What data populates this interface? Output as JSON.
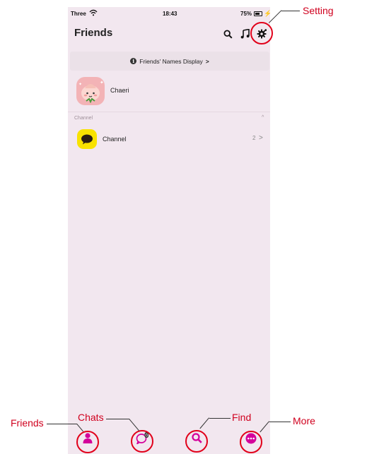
{
  "status_bar": {
    "carrier": "Three",
    "time": "18:43",
    "battery": "75%"
  },
  "header": {
    "title": "Friends"
  },
  "names_display": {
    "label": "Friends' Names Display",
    "chevron": ">"
  },
  "friends": [
    {
      "name": "Chaeri"
    }
  ],
  "channel_section": {
    "label": "Channel",
    "caret": "^",
    "item_name": "Channel",
    "count": "2",
    "chevron": ">"
  },
  "tab_bar": {
    "chats_badge": "0"
  },
  "annotations": {
    "setting": "Setting",
    "friends": "Friends",
    "chats": "Chats",
    "find": "Find",
    "more": "More"
  },
  "colors": {
    "accent": "#d4009a",
    "annotation_red": "#e1001a",
    "background": "#f2e7ef",
    "channel_yellow": "#f8e200"
  },
  "icons": [
    "wifi-icon",
    "search-icon",
    "music-note-icon",
    "gear-icon",
    "info-icon",
    "person-icon",
    "chat-bubble-icon",
    "magnifier-icon",
    "more-dots-icon"
  ]
}
